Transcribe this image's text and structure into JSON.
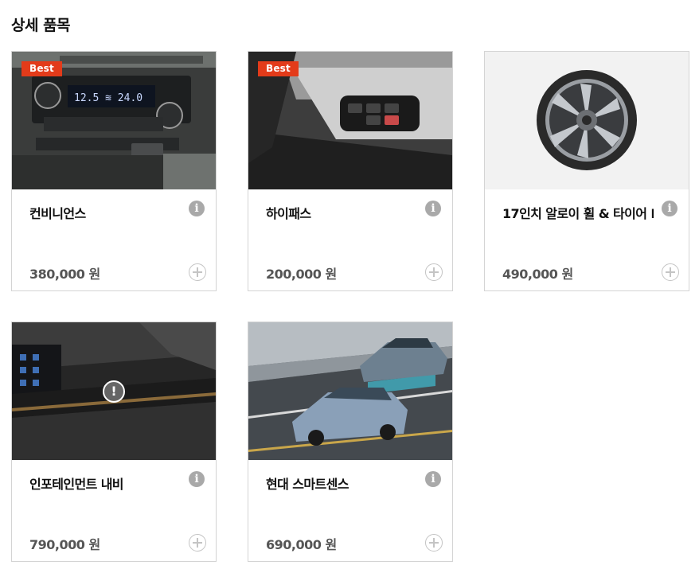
{
  "section": {
    "title": "상세 품목"
  },
  "cards": [
    {
      "name": "컨비니언스",
      "price": "380,000 원",
      "badge": "Best"
    },
    {
      "name": "하이패스",
      "price": "200,000 원",
      "badge": "Best"
    },
    {
      "name": "17인치 알로이 휠 & 타이어 I",
      "price": "490,000 원"
    },
    {
      "name": "인포테인먼트 내비",
      "price": "790,000 원"
    },
    {
      "name": "현대 스마트센스",
      "price": "690,000 원"
    }
  ],
  "icons": {
    "info": "info-icon",
    "add": "plus-circle-icon",
    "warning": "exclamation-circle-icon",
    "info_glyph": "i",
    "warning_glyph": "!"
  },
  "colors": {
    "badge": "#e33b1a",
    "border": "#d4d4d4",
    "price": "#555555",
    "info_icon": "#a9a9a9"
  }
}
